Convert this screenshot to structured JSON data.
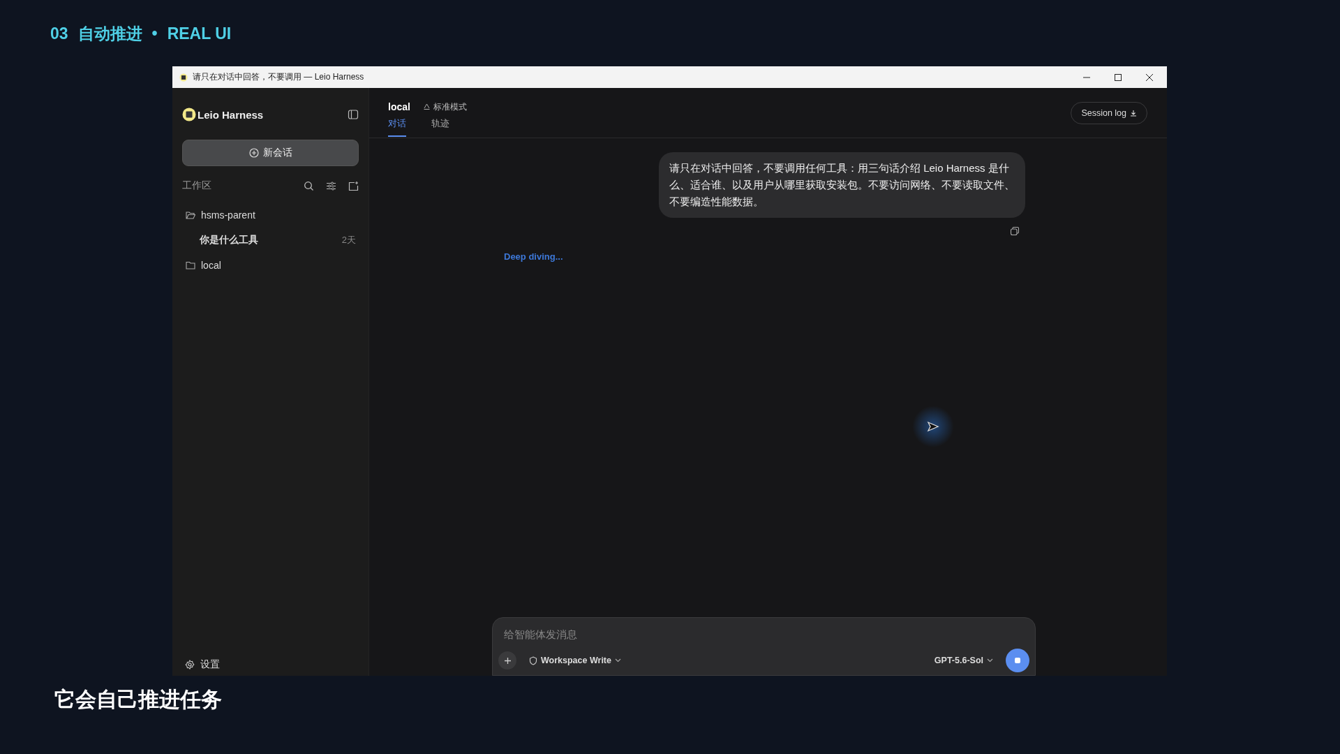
{
  "slide": {
    "number": "03",
    "heading": "自动推进",
    "separator": "•",
    "subheading": "REAL UI",
    "caption": "它会自己推进任务"
  },
  "window": {
    "title": "请只在对话中回答，不要调用 — Leio Harness"
  },
  "sidebar": {
    "brand": "Leio Harness",
    "new_chat": "新会话",
    "workspace_label": "工作区",
    "tree": [
      {
        "kind": "folder",
        "label": "hsms-parent",
        "expanded": true,
        "children": [
          {
            "kind": "session",
            "label": "你是什么工具",
            "time": "2天"
          }
        ]
      },
      {
        "kind": "folder",
        "label": "local",
        "expanded": false
      }
    ],
    "settings": "设置"
  },
  "header": {
    "workspace": "local",
    "mode": "标准模式",
    "tabs": [
      {
        "label": "对话",
        "selected": true
      },
      {
        "label": "轨迹",
        "selected": false
      }
    ],
    "session_log": "Session log"
  },
  "messages": [
    {
      "kind": "user",
      "text": "请只在对话中回答，不要调用任何工具：用三句话介绍 Leio Harness 是什么、适合谁、以及用户从哪里获取安装包。不要访问网络、不要读取文件、不要编造性能数据。"
    }
  ],
  "status": "Deep diving...",
  "composer": {
    "placeholder": "给智能体发消息",
    "permission": "Workspace Write",
    "model": "GPT-5.6-Sol",
    "running": true
  }
}
